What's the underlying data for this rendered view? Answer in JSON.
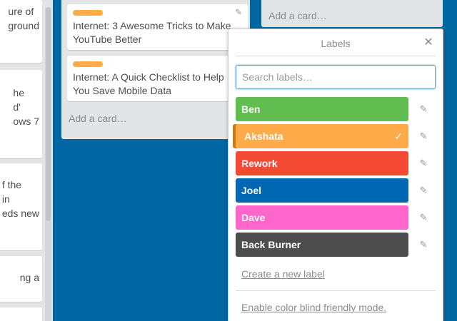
{
  "left_list": {
    "cards": [
      "ure of\nground",
      "he\nd'\nows 7",
      "f the\nin\neds new",
      "ng a",
      ""
    ]
  },
  "middle_list": {
    "cards": [
      {
        "title": "Internet: 3 Awesome Tricks to Make YouTube Better",
        "label_color": "#ffab4a"
      },
      {
        "title": "Internet: A Quick Checklist to Help You Save Mobile Data",
        "label_color": "#ffab4a"
      }
    ],
    "add_card": "Add a card…"
  },
  "right_list": {
    "add_card": "Add a card…"
  },
  "popover": {
    "title": "Labels",
    "close_icon": "close-icon",
    "search_placeholder": "Search labels…",
    "labels": [
      {
        "name": "Ben",
        "color": "#00c853",
        "selected": false
      },
      {
        "name": "Akshata",
        "color": "#ffab30",
        "selected": true
      },
      {
        "name": "Rework",
        "color": "#f44336",
        "selected": false
      },
      {
        "name": "Joel",
        "color": "#0067b3",
        "selected": false
      },
      {
        "name": "Dave",
        "color": "#ff66cc",
        "selected": false
      },
      {
        "name": "Back Burner",
        "color": "#4d4d4d",
        "selected": false
      }
    ],
    "create_label": "Create a new label",
    "color_blind": "Enable color blind friendly mode."
  }
}
